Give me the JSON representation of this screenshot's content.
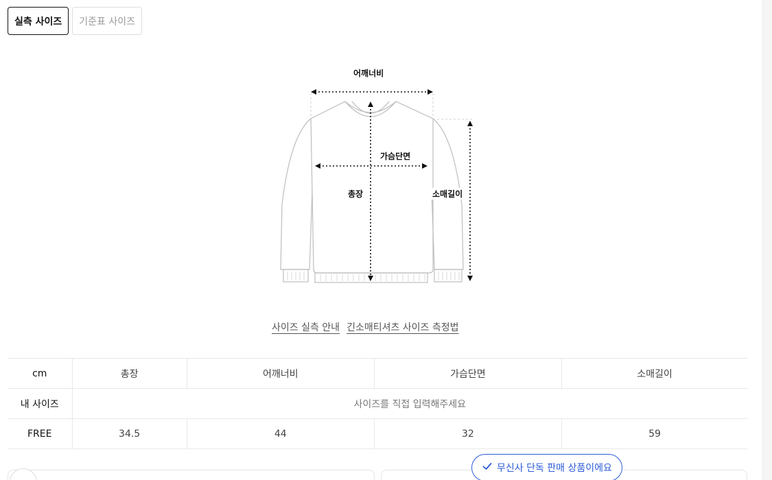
{
  "tabs": [
    {
      "label": "실측 사이즈",
      "active": true
    },
    {
      "label": "기준표 사이즈",
      "active": false
    }
  ],
  "diagram": {
    "labels": {
      "shoulder": "어깨너비",
      "chest": "가슴단면",
      "length": "총장",
      "sleeve": "소매길이"
    }
  },
  "guide_links": [
    "사이즈 실측 안내",
    "긴소매티셔츠 사이즈 측정법"
  ],
  "size_table": {
    "unit": "cm",
    "headers": [
      "총장",
      "어깨너비",
      "가슴단면",
      "소매길이"
    ],
    "my_size": {
      "label": "내 사이즈",
      "placeholder": "사이즈를 직접 입력해주세요"
    },
    "rows": [
      {
        "size": "FREE",
        "values": [
          "34.5",
          "44",
          "32",
          "59"
        ]
      }
    ]
  },
  "badge": {
    "text": "무신사 단독 판매 상품이에요",
    "icon": "check-icon",
    "color": "#2b5bd7"
  }
}
